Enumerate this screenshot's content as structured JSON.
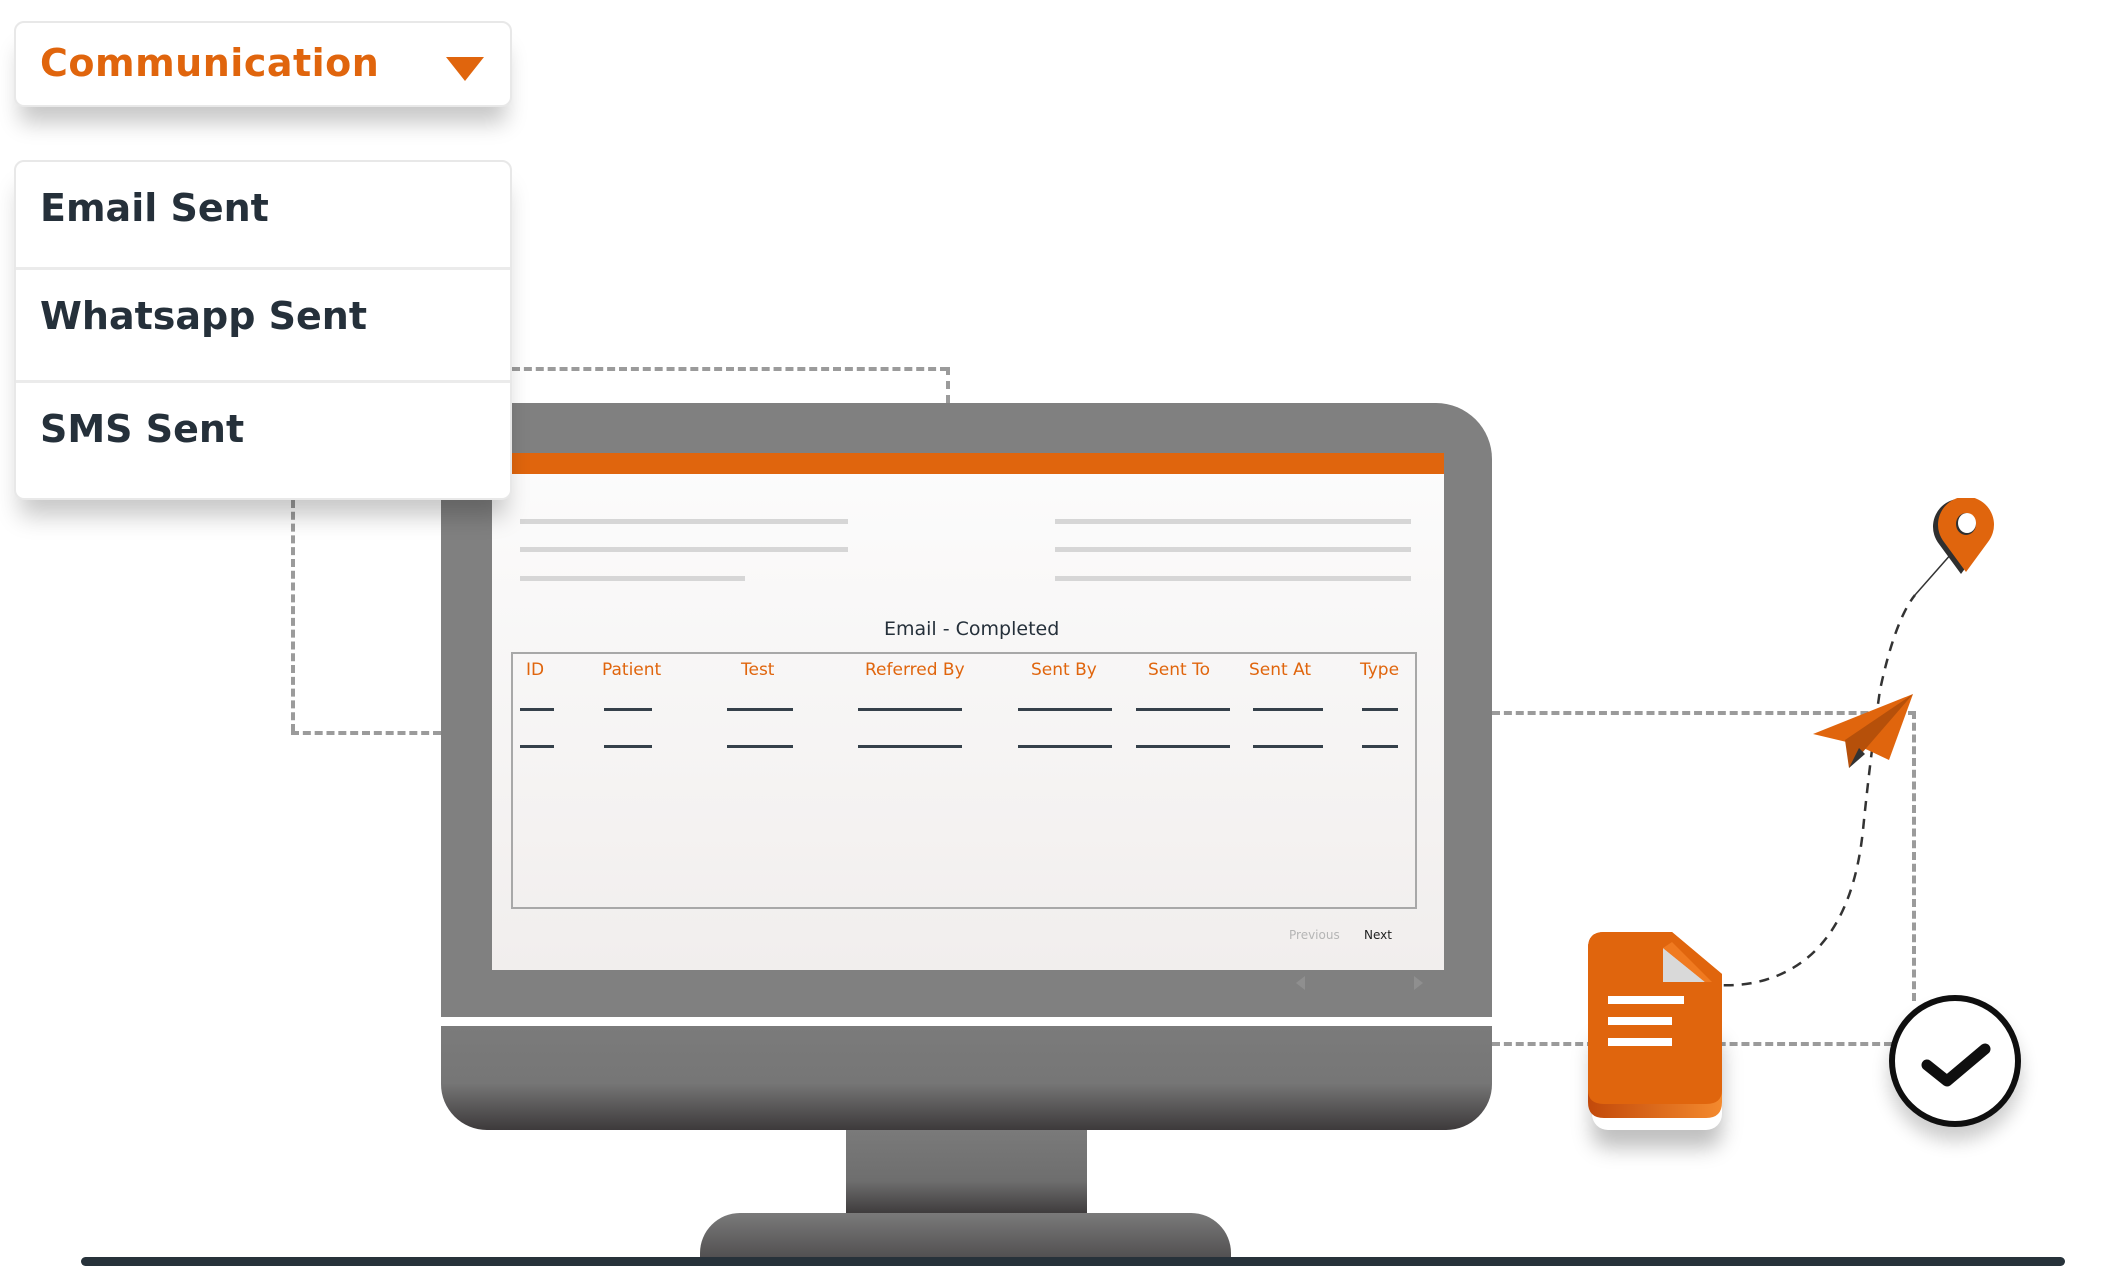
{
  "dropdown": {
    "selected": "Communication",
    "icon": "caret-down-icon",
    "accent_color": "#e0650d"
  },
  "menu": {
    "items": [
      {
        "label": "Email Sent"
      },
      {
        "label": "Whatsapp Sent"
      },
      {
        "label": "SMS Sent"
      }
    ]
  },
  "screen": {
    "header_color": "#e0650d",
    "table_title": "Email - Completed",
    "columns": [
      "ID",
      "Patient",
      "Test",
      "Referred By",
      "Sent By",
      "Sent To",
      "Sent At",
      "Type"
    ],
    "rows": [
      [
        "—",
        "—",
        "—",
        "—",
        "—",
        "—",
        "—",
        "—"
      ],
      [
        "—",
        "—",
        "—",
        "—",
        "—",
        "—",
        "—",
        "—"
      ]
    ],
    "pagination": {
      "previous": "Previous",
      "next": "Next"
    }
  },
  "illustration": {
    "icons": [
      "location-pin-icon",
      "paper-plane-icon",
      "document-icon",
      "check-circle-icon"
    ]
  }
}
